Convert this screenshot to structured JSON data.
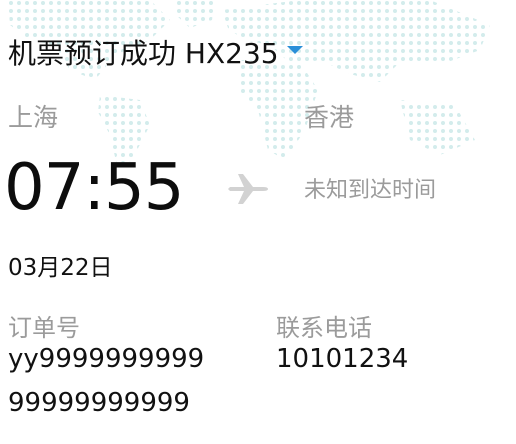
{
  "header": {
    "title": "机票预订成功 HX235",
    "caret_color": "#2a8fd8"
  },
  "flight": {
    "departure_city": "上海",
    "arrival_city": "香港",
    "departure_time": "07:55",
    "arrival_time": "未知到达时间",
    "date": "03月22日",
    "plane_icon": "airplane-icon"
  },
  "booking": {
    "order_label": "订单号",
    "order_number_line1": "yy9999999999",
    "order_number_line2": "99999999999",
    "phone_label": "联系电话",
    "phone_number": "10101234"
  }
}
